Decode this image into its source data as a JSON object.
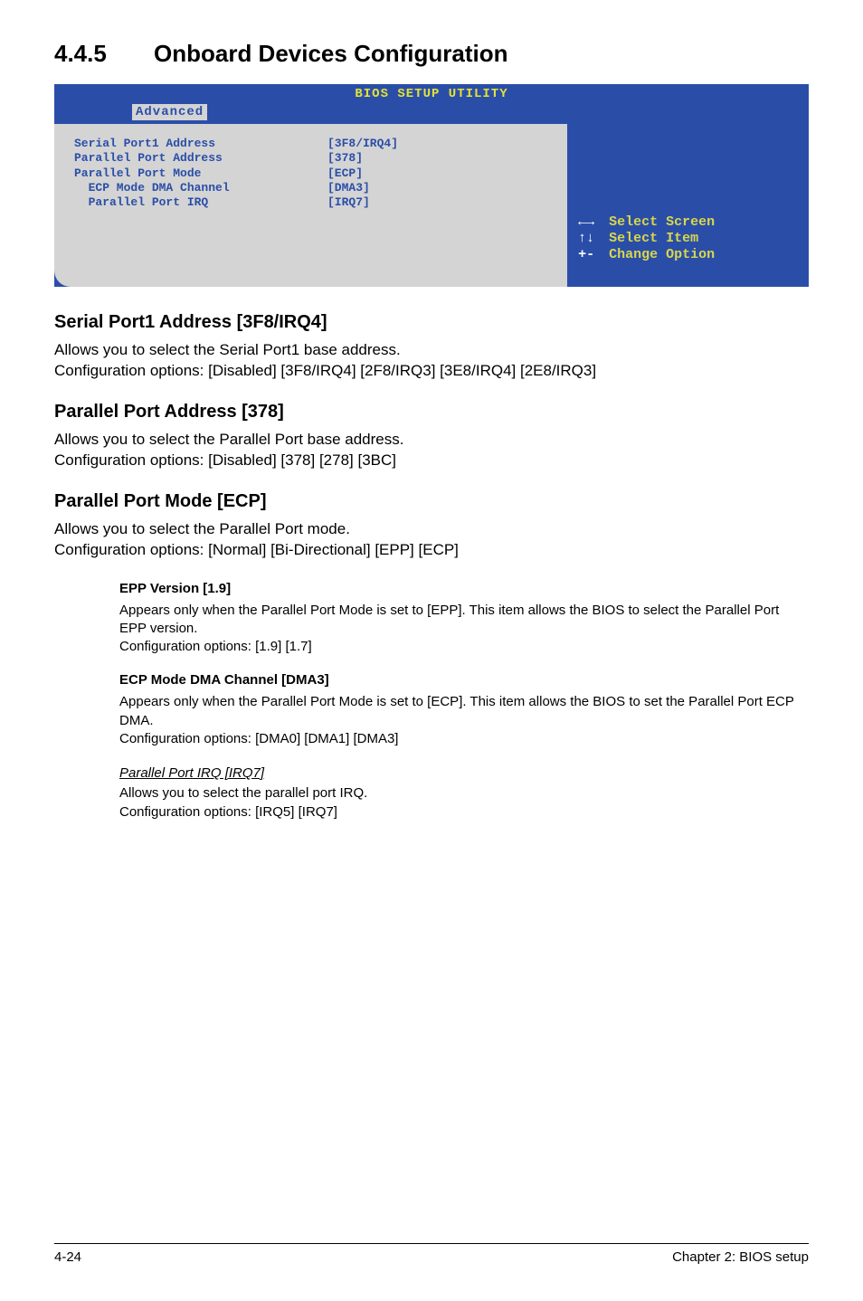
{
  "section": {
    "number": "4.4.5",
    "title": "Onboard Devices Configuration"
  },
  "bios": {
    "header_title": "BIOS SETUP UTILITY",
    "tab": "Advanced",
    "rows": [
      {
        "label": "Serial Port1 Address",
        "value": "[3F8/IRQ4]"
      },
      {
        "label": "Parallel Port Address",
        "value": "[378]"
      },
      {
        "label": "Parallel Port Mode",
        "value": "[ECP]"
      },
      {
        "label": "  ECP Mode DMA Channel",
        "value": "[DMA3]"
      },
      {
        "label": "  Parallel Port IRQ",
        "value": "[IRQ7]"
      }
    ],
    "hints": [
      {
        "key": "←→",
        "text": "Select Screen"
      },
      {
        "key": "↑↓",
        "text": "Select Item"
      },
      {
        "key": "+-",
        "text": "Change Option"
      }
    ]
  },
  "subs": [
    {
      "title": "Serial Port1 Address [3F8/IRQ4]",
      "body": "Allows you to select the Serial Port1 base address.\nConfiguration options: [Disabled] [3F8/IRQ4] [2F8/IRQ3] [3E8/IRQ4] [2E8/IRQ3]"
    },
    {
      "title": "Parallel Port Address [378]",
      "body": "Allows you to select the Parallel Port base address.\nConfiguration options: [Disabled] [378] [278] [3BC]"
    },
    {
      "title": "Parallel Port Mode [ECP]",
      "body": "Allows you to select the Parallel Port mode.\nConfiguration options: [Normal] [Bi-Directional] [EPP] [ECP]"
    }
  ],
  "nested": [
    {
      "title": "EPP Version [1.9]",
      "body": "Appears only when the Parallel Port Mode is set to [EPP]. This item allows the BIOS to select the Parallel Port EPP version.\nConfiguration options: [1.9] [1.7]"
    },
    {
      "title": "ECP Mode DMA Channel [DMA3]",
      "body": "Appears only when the Parallel Port Mode is set to [ECP]. This item allows the BIOS to set the Parallel Port ECP DMA.\nConfiguration options: [DMA0] [DMA1] [DMA3]"
    }
  ],
  "italic_sub": {
    "title": "Parallel Port IRQ [IRQ7]",
    "body": "Allows you to select the parallel port IRQ.\nConfiguration options: [IRQ5] [IRQ7]"
  },
  "footer": {
    "left": "4-24",
    "right": "Chapter 2: BIOS setup"
  }
}
